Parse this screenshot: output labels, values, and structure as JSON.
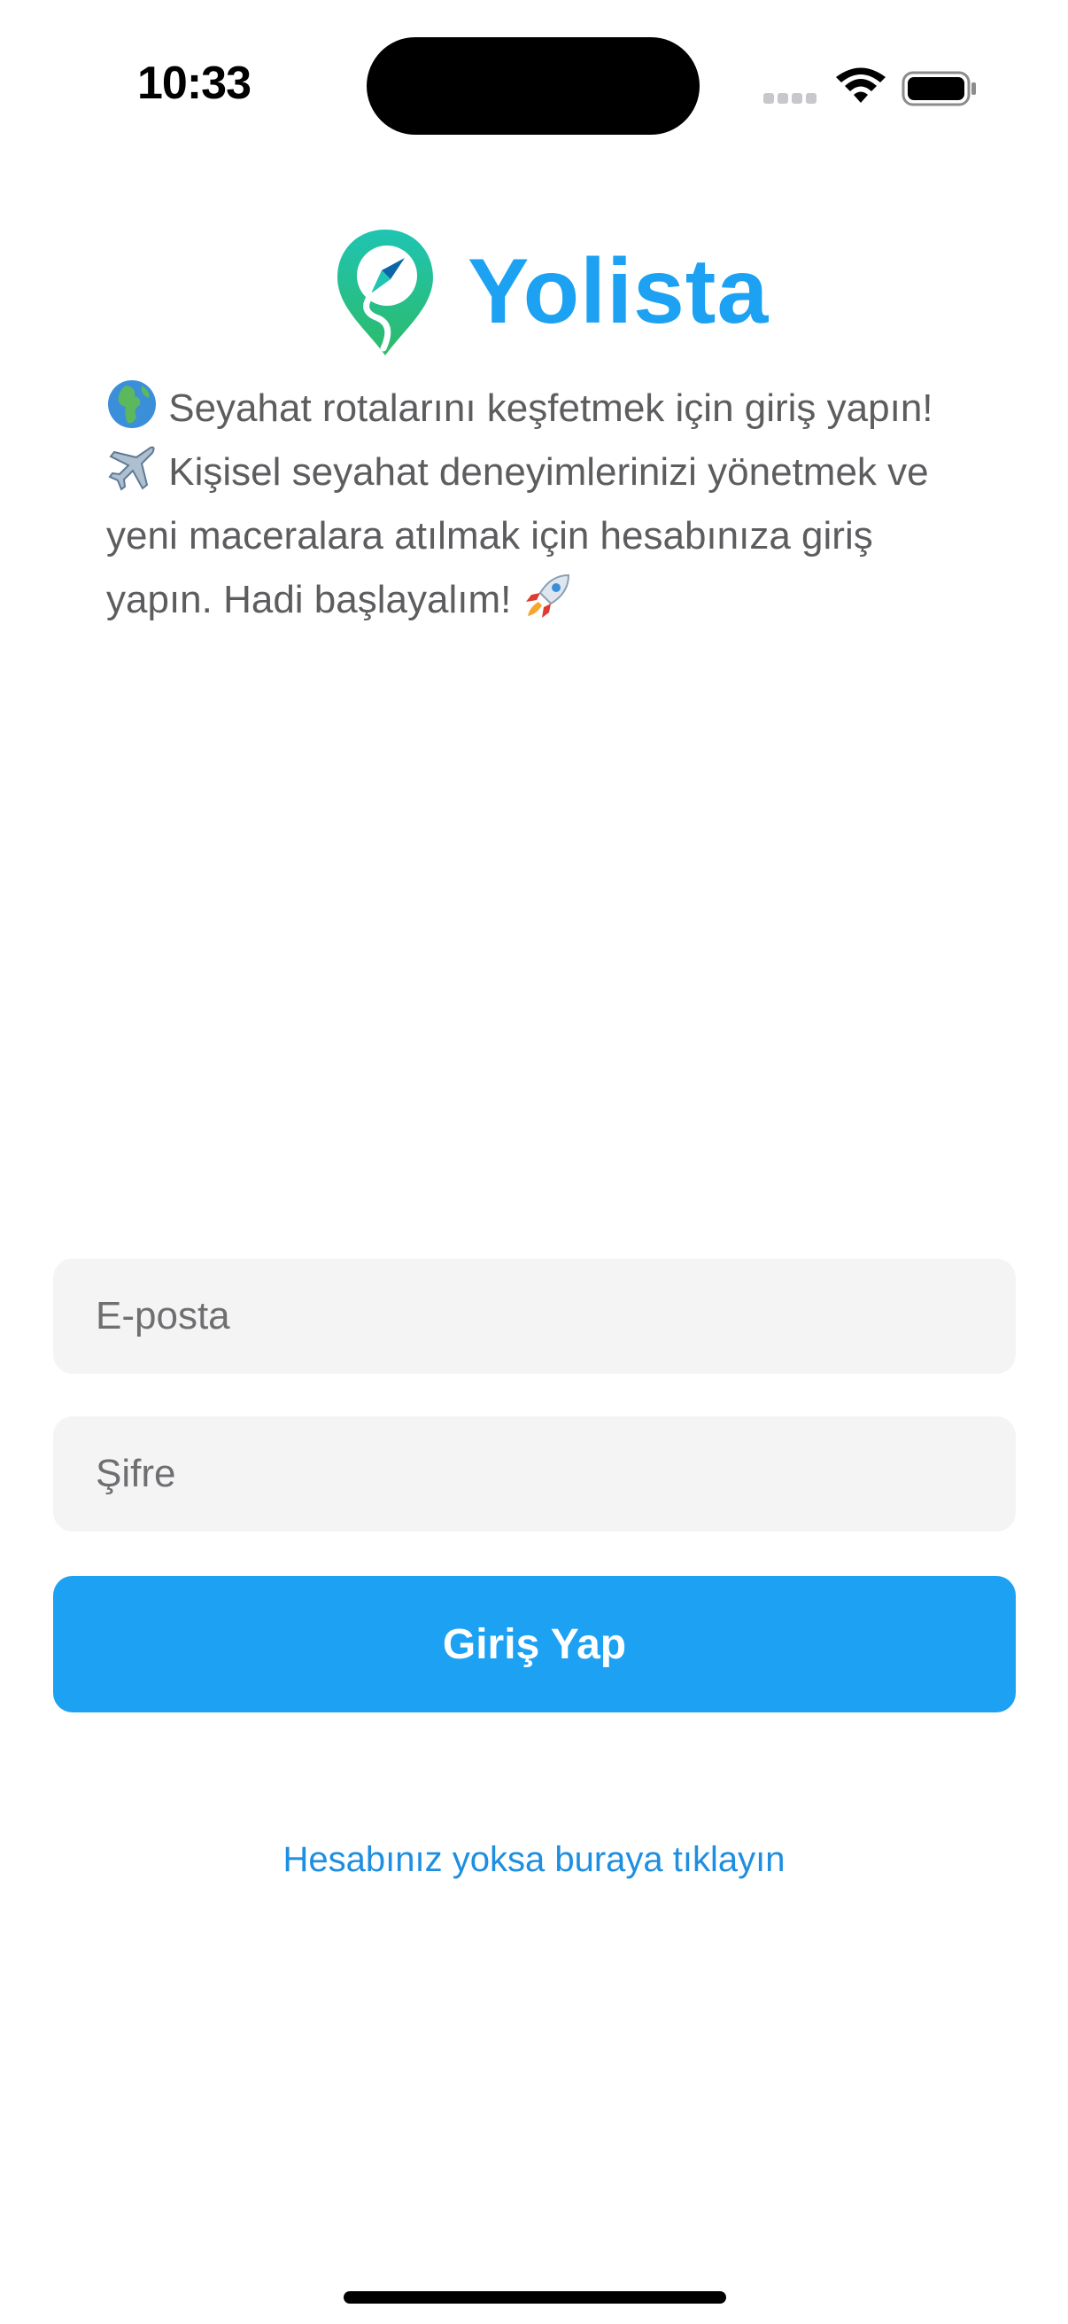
{
  "status_bar": {
    "time": "10:33"
  },
  "brand": {
    "name": "Yolista",
    "accent_color": "#1da1f2",
    "logo_icon": "map-pin-compass-icon"
  },
  "intro": {
    "line1_emoji": "globe-europe-africa-icon",
    "part1": "Seyahat rotalarını keşfetmek için giriş yapın!",
    "part2_emoji": "airplane-icon",
    "part2": "Kişisel seyahat deneyimlerinizi yönetmek ve yeni maceralara atılmak için hesabınıza giriş yapın. Hadi başlayalım!",
    "part3_emoji": "rocket-icon"
  },
  "form": {
    "email_placeholder": "E-posta",
    "password_placeholder": "Şifre",
    "login_label": "Giriş Yap",
    "signup_link": "Hesabınız yoksa buraya tıklayın"
  }
}
